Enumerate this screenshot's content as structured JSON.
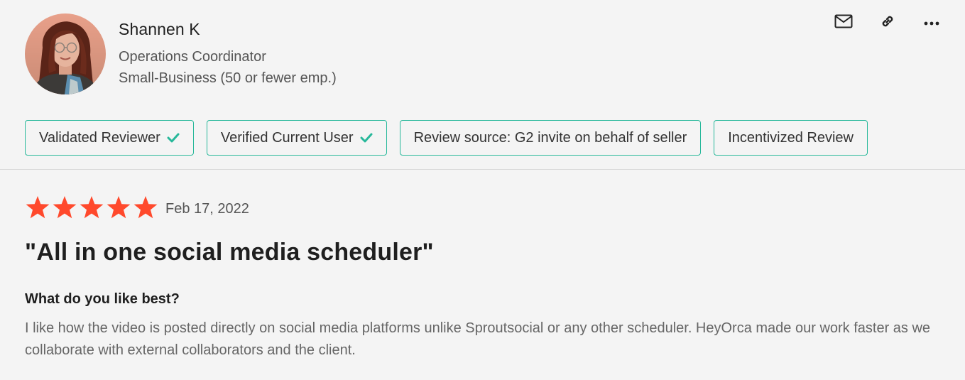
{
  "reviewer": {
    "name": "Shannen K",
    "role": "Operations Coordinator",
    "company_size": "Small-Business (50 or fewer emp.)"
  },
  "actions": [
    {
      "icon": "mail-icon"
    },
    {
      "icon": "link-icon"
    },
    {
      "icon": "more-icon"
    }
  ],
  "badges": [
    {
      "label": "Validated Reviewer",
      "checked": true
    },
    {
      "label": "Verified Current User",
      "checked": true
    },
    {
      "label": "Review source: G2 invite on behalf of seller",
      "checked": false
    },
    {
      "label": "Incentivized Review",
      "checked": false
    }
  ],
  "review": {
    "rating": 5,
    "max_rating": 5,
    "date": "Feb 17, 2022",
    "title": "\"All in one social media scheduler\"",
    "question": "What do you like best?",
    "answer": "I like how the video is posted directly on social media platforms unlike Sproutsocial or any other scheduler. HeyOrca made our work faster as we collaborate with external collaborators and the client."
  },
  "colors": {
    "accent": "#27b89a",
    "star": "#ff492c"
  }
}
